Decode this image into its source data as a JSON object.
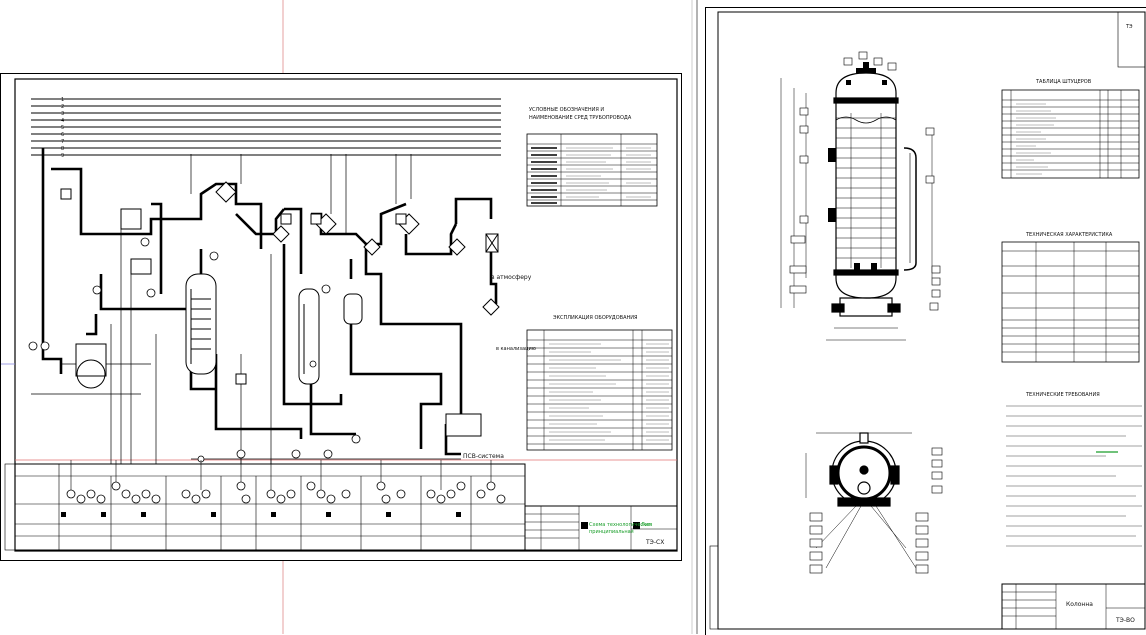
{
  "sheets": {
    "left": {
      "legend_title": "УСЛОВНЫЕ ОБОЗНАЧЕНИЯ И НАИМЕНОВАНИЕ СРЕД ТРУБОПРОВОДА",
      "equipment_title": "ЭКСПЛИКАЦИЯ ОБОРУДОВАНИЯ",
      "outlet_label": "в атмосферу",
      "bottom_label": "ПСВ-система",
      "stamp_code": "ТЭ-СХ",
      "stamp_note": "Схема технологическая"
    },
    "right": {
      "nozzle_table_title": "ТАБЛИЦА ШТУЦЕРОВ",
      "tech_char_title": "ТЕХНИЧЕСКАЯ ХАРАКТЕРИСТИКА",
      "tech_req_title": "ТЕХНИЧЕСКИЕ ТРЕБОВАНИЯ",
      "stamp_title": "Колонна",
      "stamp_code": "ТЭ-ВО"
    }
  },
  "colors": {
    "workspace": "#ffffff",
    "line": "#000000",
    "accent_green": "#1a9e2a",
    "guide_red": "#e07070",
    "guide_blue": "#8a8ae0",
    "window_border": "#9a9a9a"
  }
}
